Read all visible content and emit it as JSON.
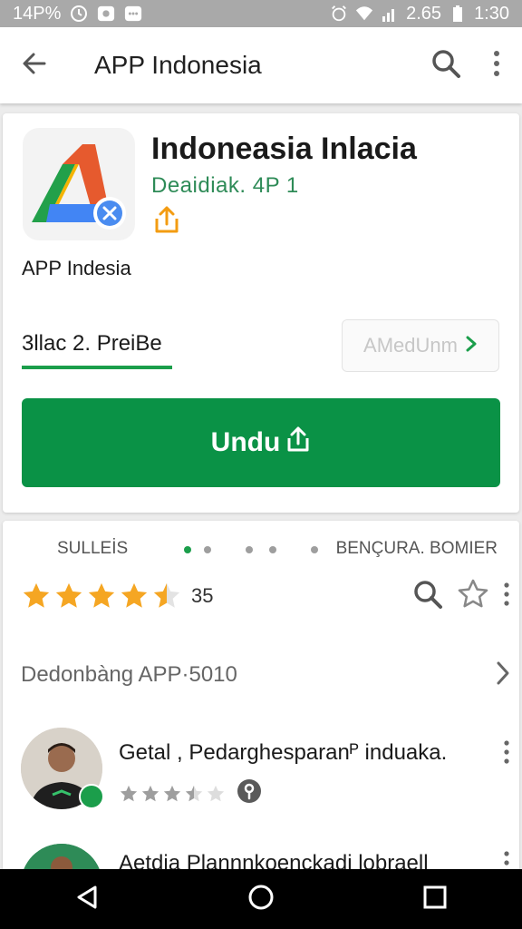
{
  "status_bar": {
    "left_text": "14P%",
    "right_text": "2.65",
    "time": "1:30"
  },
  "app_bar": {
    "title": "APP Indonesia",
    "back_icon": "arrow-left-icon",
    "search_icon": "search-icon",
    "overflow_icon": "more-vert-icon"
  },
  "app_header": {
    "name": "Indoneasia Inlacia",
    "developer": "Deaidiak. 4P 1",
    "subtitle": "APP Indesia",
    "tab_label": "3llac 2. PreiBe",
    "more_button": "AMedUnm",
    "install_button": "Undu",
    "colors": {
      "accent": "#0a9246",
      "developer": "#2e8b57"
    }
  },
  "details": {
    "tab_left": "SULLEİS",
    "tab_right": "BENÇURA. BOMIER",
    "rating_value": 4.5,
    "rating_count": "35",
    "section_title": "Dedonbàng APP·5010",
    "reviews": [
      {
        "text": "Getal , Pedarghesparanᴾ induaka.",
        "stars": 3.5
      },
      {
        "text": "Aetdia Plannnkoenckadi lobraell",
        "stars": 0
      }
    ]
  },
  "nav_bar": {
    "back_icon": "nav-back-icon",
    "home_icon": "nav-home-icon",
    "recents_icon": "nav-recents-icon"
  }
}
